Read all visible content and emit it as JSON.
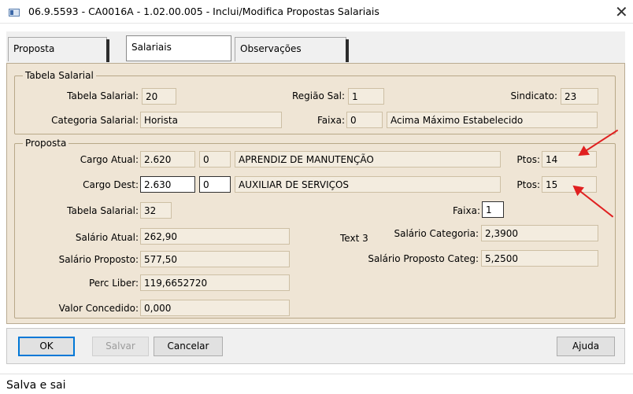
{
  "window": {
    "title": "06.9.5593 - CA0016A - 1.02.00.005 - Inclui/Modifica Propostas Salariais",
    "close": "✕"
  },
  "tabs": [
    "Proposta",
    "Salariais",
    "Observações"
  ],
  "tabela_group": {
    "legend": "Tabela Salarial",
    "tabela_label": "Tabela Salarial:",
    "tabela_value": "20",
    "regiao_label": "Região Sal:",
    "regiao_value": "1",
    "sindicato_label": "Sindicato:",
    "sindicato_value": "23",
    "categoria_label": "Categoria Salarial:",
    "categoria_value": "Horista",
    "faixa_label": "Faixa:",
    "faixa_value": "0",
    "faixa_desc": "Acima Máximo Estabelecido"
  },
  "proposta_group": {
    "legend": "Proposta",
    "cargo_atual_label": "Cargo Atual:",
    "cargo_atual_code": "2.620",
    "cargo_atual_level": "0",
    "cargo_atual_desc": "APRENDIZ DE MANUTENÇÃO",
    "ptos1_label": "Ptos:",
    "ptos1_value": "14",
    "cargo_dest_label": "Cargo Dest:",
    "cargo_dest_code": "2.630",
    "cargo_dest_level": "0",
    "cargo_dest_desc": "AUXILIAR DE SERVIÇOS",
    "ptos2_label": "Ptos:",
    "ptos2_value": "15",
    "tabela_label": "Tabela Salarial:",
    "tabela_value": "32",
    "faixa_label": "Faixa:",
    "faixa_value": "1",
    "salario_atual_label": "Salário Atual:",
    "salario_atual_value": "262,90",
    "salario_categoria_label": "Salário Categoria:",
    "salario_categoria_value": "2,3900",
    "salario_proposto_label": "Salário Proposto:",
    "salario_proposto_value": "577,50",
    "salario_proposto_categ_label": "Salário Proposto Categ:",
    "salario_proposto_categ_value": "5,2500",
    "perc_liber_label": "Perc Liber:",
    "perc_liber_value": "119,6652720",
    "valor_concedido_label": "Valor Concedido:",
    "valor_concedido_value": "0,000",
    "text3": "Text 3"
  },
  "buttons": {
    "ok": "OK",
    "salvar": "Salvar",
    "cancelar": "Cancelar",
    "ajuda": "Ajuda"
  },
  "status": "Salva e sai",
  "colors": {
    "panel": "#efe5d5",
    "arrow": "#e02020",
    "focus": "#0078d7"
  }
}
